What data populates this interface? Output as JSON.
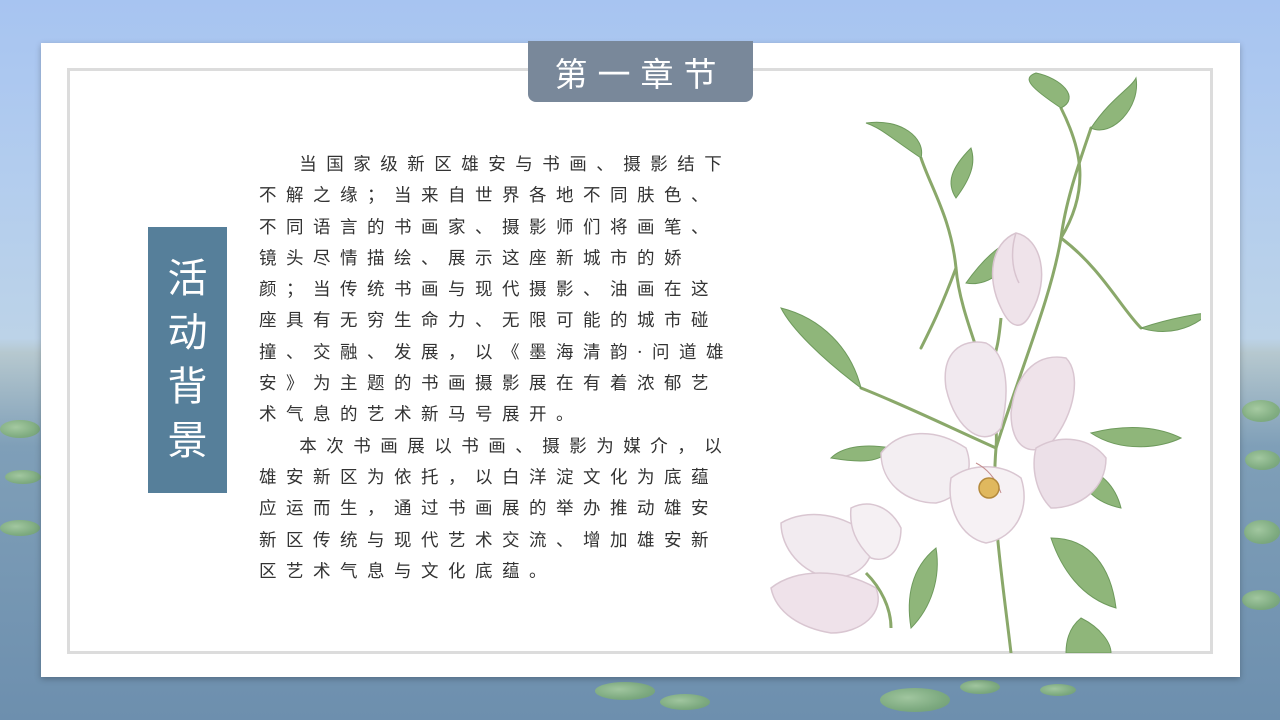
{
  "slide": {
    "chapter_label": "第一章节",
    "section_title": [
      "活",
      "动",
      "背",
      "景"
    ],
    "paragraphs": [
      "当国家级新区雄安与书画、摄影结下不解之缘；当来自世界各地不同肤色、不同语言的书画家、摄影师们将画笔、镜头尽情描绘、展示这座新城市的娇颜；当传统书画与现代摄影、油画在这座具有无穷生命力、无限可能的城市碰撞、交融、发展，以《墨海清韵·问道雄安》为主题的书画摄影展在有着浓郁艺术气息的艺术新马号展开。",
      "本次书画展以书画、摄影为媒介，以雄安新区为依托，以白洋淀文化为底蕴应运而生，通过书画展的举办推动雄安新区传统与现代艺术交流、增加雄安新区艺术气息与文化底蕴。"
    ]
  },
  "colors": {
    "tab_bg": "#79889a",
    "title_bg": "#567f9a",
    "text": "#333333",
    "frame": "#dcdcdc"
  },
  "decor": {
    "background": "lake-landscape",
    "illustration": "magnolia-watercolor"
  }
}
